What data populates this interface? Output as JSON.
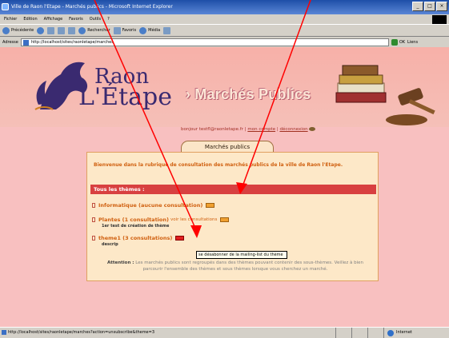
{
  "window": {
    "title": "Ville de Raon l'Etape - Marchés publics - Microsoft Internet Explorer",
    "buttons": [
      "_",
      "□",
      "×"
    ]
  },
  "menubar": [
    "Fichier",
    "Edition",
    "Affichage",
    "Favoris",
    "Outils",
    "?"
  ],
  "toolbar": {
    "back": "Précédente",
    "search": "Rechercher",
    "favorites": "Favoris",
    "media": "Média"
  },
  "address": {
    "label": "Adresse",
    "url": "http://localhost/sites/raonletape/marches",
    "go": "OK",
    "links": "Liens"
  },
  "site": {
    "logo_line1": "Raon",
    "logo_line2": "L'Étape",
    "section_title": "› Marchés Publics"
  },
  "user": {
    "greeting": "bonjour testfl@raonletape.fr |",
    "account_link": "mon compte",
    "sep": "|",
    "logout_link": "déconnexion"
  },
  "tab_label": "Marchés publics",
  "intro_text": "Bienvenue dans la rubrique de consultation des marchés publics de la ville de Raon l'Etape.",
  "themes_header": "Tous les thèmes :",
  "themes": [
    {
      "label": "Informatique (aucune consultation)",
      "desc": ""
    },
    {
      "label": "Plantes (1 consultation)",
      "link": "voir les consultations",
      "desc": "1er test de création de thème"
    },
    {
      "label": "theme1 (3 consultations)",
      "desc": "descrip"
    }
  ],
  "tooltip": "se désabonner de la mailing-list du thème",
  "note": {
    "label": "Attention :",
    "text": "Les marchés publics sont regroupés dans des thèmes pouvant contenir des sous-thèmes. Veillez à bien parcourir l'ensemble des thèmes et sous thèmes lorsque vous cherchez un marché."
  },
  "status": {
    "url": "http://localhost/sites/raonletape/marches?action=unsubscribe&theme=3",
    "zone": "Internet"
  }
}
